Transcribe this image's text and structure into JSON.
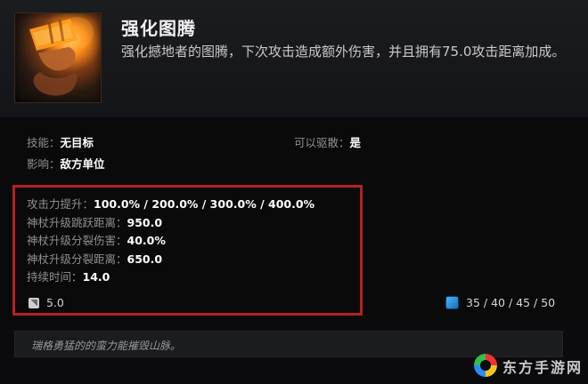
{
  "ability": {
    "icon": "empowered-totem-icon",
    "title": "强化图腾",
    "description": "强化撼地者的图腾，下次攻击造成额外伤害，并且拥有75.0攻击距离加成。"
  },
  "stats": {
    "skill_label": "技能：",
    "skill_value": "无目标",
    "affects_label": "影响：",
    "affects_value": "敌方单位",
    "dispel_label": "可以驱散：",
    "dispel_value": "是"
  },
  "attributes": [
    {
      "label": "攻击力提升：",
      "value": "100.0% / 200.0% / 300.0% / 400.0%"
    },
    {
      "label": "神杖升级跳跃距离：",
      "value": "950.0"
    },
    {
      "label": "神杖升级分裂伤害：",
      "value": "40.0%"
    },
    {
      "label": "神杖升级分裂距离：",
      "value": "650.0"
    },
    {
      "label": "持续时间：",
      "value": "14.0"
    }
  ],
  "cooldown": {
    "icon": "cooldown-icon",
    "value": "5.0"
  },
  "mana": {
    "icon": "mana-icon",
    "value": "35 / 40 / 45 / 50"
  },
  "lore": "瑞格勇猛的的蛮力能摧毁山脉。",
  "watermark": {
    "text": "东方手游网"
  },
  "colors": {
    "highlight_border": "#b52020",
    "mana_blue": "#2a8cff"
  }
}
